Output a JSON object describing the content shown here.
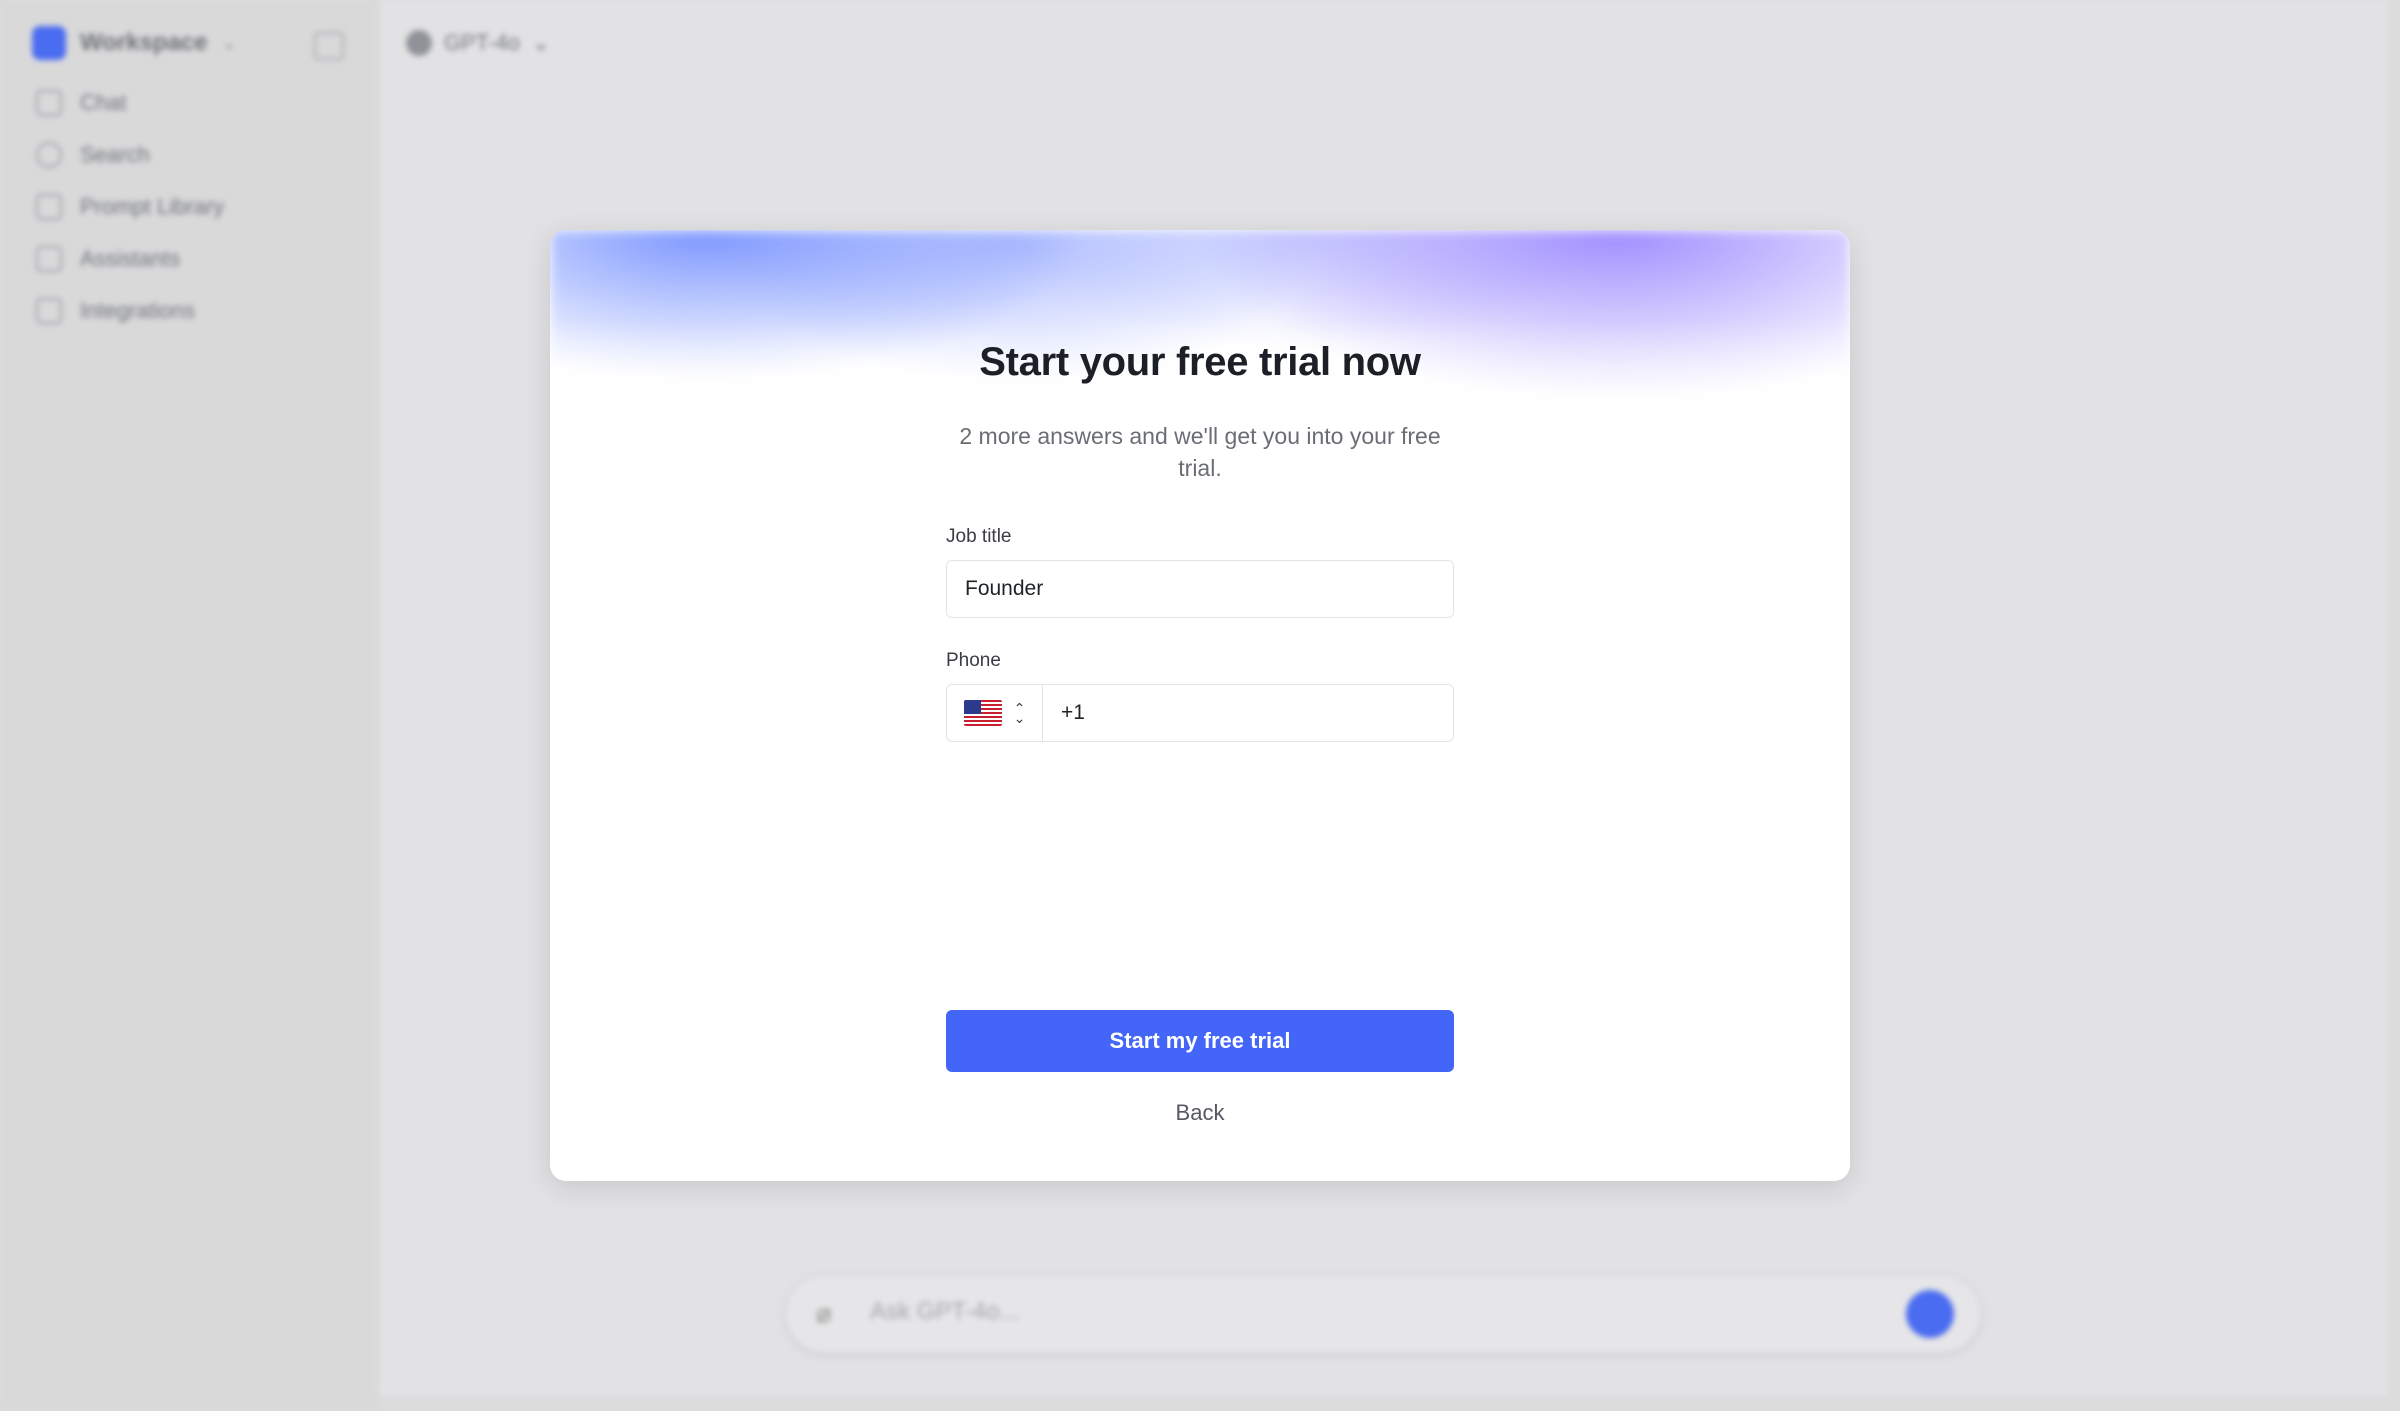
{
  "app": {
    "workspace_name": "Workspace",
    "sidebar": {
      "items": [
        {
          "label": "Chat",
          "icon": "chat-icon"
        },
        {
          "label": "Search",
          "icon": "search-icon"
        },
        {
          "label": "Prompt Library",
          "icon": "library-icon"
        },
        {
          "label": "Assistants",
          "icon": "assistants-icon"
        },
        {
          "label": "Integrations",
          "icon": "integrations-icon"
        }
      ]
    },
    "model_picker": {
      "label": "GPT-4o"
    },
    "composer": {
      "placeholder": "Ask GPT-4o..."
    }
  },
  "modal": {
    "title": "Start your free trial now",
    "subtitle": "2 more answers and we'll get you into your free trial.",
    "job_title": {
      "label": "Job title",
      "value": "Founder"
    },
    "phone": {
      "label": "Phone",
      "country": "US",
      "value": "+1"
    },
    "cta_label": "Start my free trial",
    "back_label": "Back",
    "accent_color": "#4466f8"
  }
}
